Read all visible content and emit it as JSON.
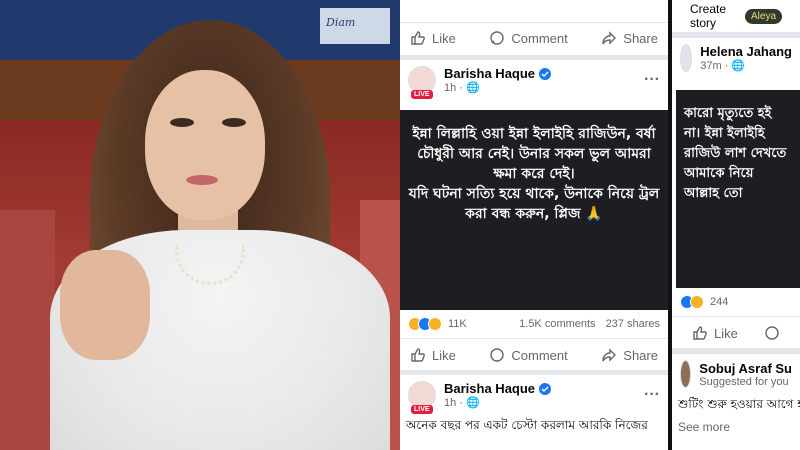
{
  "colors": {
    "facebook_blue": "#1877f2",
    "live_red": "#e41e3f"
  },
  "photo": {
    "sign_text": "Diam"
  },
  "top_actions": {
    "like": "Like",
    "comment": "Comment",
    "share": "Share"
  },
  "post1": {
    "author": "Barisha Haque",
    "time": "1h",
    "live": "LIVE",
    "text": "ইন্না লিল্লাহি ওয়া ইন্না ইলাইহি রাজিউন, বর্ষা চৌধুরী আর নেই। উনার সকল ভুল আমরা ক্ষমা করে দেই।\nযদি ঘটনা সত্যি হয়ে থাকে, উনাকে নিয়ে ট্রল করা বন্ধ করুন, প্লিজ 🙏",
    "reactions_count": "11K",
    "comments": "1.5K comments",
    "shares": "237 shares"
  },
  "post2": {
    "author": "Barisha Haque",
    "time": "1h",
    "live": "LIVE",
    "snippet": "অনেক বছর পর একট চেস্টা করলাম আরকি নিজের"
  },
  "right_col": {
    "create_story": "Create story",
    "story_name": "Aleya",
    "helena_name": "Helena Jahang",
    "helena_time": "37m",
    "helena_text": "কারো মৃত্যুতে হই না। ইন্না ইলাইহি রাজিউ লাশ দেখতে আমাকে নিয়ে আল্লাহ তো",
    "reactions_count": "244",
    "like": "Like",
    "sobuj_name": "Sobuj Asraf Su",
    "suggested": "Suggested for you",
    "sobuj_text": "শুটিং শুরু হওয়ার আগে হয় 😊...",
    "see_more": "See more"
  }
}
